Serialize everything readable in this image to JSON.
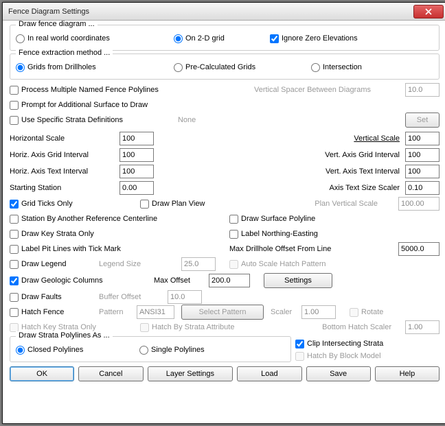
{
  "window": {
    "title": "Fence Diagram Settings"
  },
  "group_draw": {
    "legend": "Draw fence diagram ...",
    "opt_real_world": "In real world coordinates",
    "opt_on2d": "On 2-D grid",
    "ignore_zero": "Ignore Zero Elevations"
  },
  "group_extract": {
    "legend": "Fence extraction method ...",
    "opt_grids": "Grids from Drillholes",
    "opt_precalc": "Pre-Calculated Grids",
    "opt_intersect": "Intersection"
  },
  "proc_multi": "Process Multiple Named Fence Polylines",
  "vspacer_lbl": "Vertical Spacer Between Diagrams",
  "vspacer_val": "10.0",
  "prompt_add_surface": "Prompt for Additional Surface to Draw",
  "use_specific_strata": "Use Specific Strata Definitions",
  "none_lbl": "None",
  "set_btn": "Set",
  "scales": {
    "hscale_lbl": "Horizontal Scale",
    "hscale_val": "100",
    "vscale_lbl": "Vertical Scale",
    "vscale_val": "100",
    "hgrid_lbl": "Horiz. Axis Grid Interval",
    "hgrid_val": "100",
    "vgrid_lbl": "Vert. Axis Grid Interval",
    "vgrid_val": "100",
    "htext_lbl": "Horiz. Axis Text Interval",
    "htext_val": "100",
    "vtext_lbl": "Vert. Axis Text Interval",
    "vtext_val": "100",
    "start_lbl": "Starting Station",
    "start_val": "0.00",
    "atsize_lbl": "Axis Text Size Scaler",
    "atsize_val": "0.10"
  },
  "grid_ticks": "Grid Ticks Only",
  "draw_plan": "Draw Plan View",
  "plan_vscale_lbl": "Plan Vertical Scale",
  "plan_vscale_val": "100.00",
  "station_ref": "Station By Another Reference Centerline",
  "draw_surface_poly": "Draw Surface Polyline",
  "draw_key_strata": "Draw Key Strata Only",
  "label_ne": "Label Northing-Easting",
  "label_pit": "Label Pit Lines with Tick Mark",
  "max_drill_lbl": "Max Drillhole Offset From Line",
  "max_drill_val": "5000.0",
  "draw_legend": "Draw Legend",
  "legend_size_lbl": "Legend Size",
  "legend_size_val": "25.0",
  "auto_hatch": "Auto Scale Hatch Pattern",
  "draw_geo": "Draw Geologic Columns",
  "max_offset_lbl": "Max Offset",
  "max_offset_val": "200.0",
  "settings_btn": "Settings",
  "draw_faults": "Draw Faults",
  "buffer_lbl": "Buffer Offset",
  "buffer_val": "10.0",
  "hatch_fence": "Hatch Fence",
  "pattern_lbl": "Pattern",
  "pattern_val": "ANSI31",
  "select_pattern_btn": "Select Pattern",
  "scaler_lbl": "Scaler",
  "scaler_val": "1.00",
  "rotate_lbl": "Rotate",
  "hatch_key_strata": "Hatch Key Strata Only",
  "hatch_by_strata_attr": "Hatch By Strata Attribute",
  "bottom_hatch_lbl": "Bottom Hatch Scaler",
  "bottom_hatch_val": "1.00",
  "group_polylines": {
    "legend": "Draw Strata Polylines As ...",
    "opt_closed": "Closed Polylines",
    "opt_single": "Single Polylines",
    "clip_inter": "Clip Intersecting Strata",
    "hatch_block": "Hatch By Block Model"
  },
  "buttons": {
    "ok": "OK",
    "cancel": "Cancel",
    "layer": "Layer Settings",
    "load": "Load",
    "save": "Save",
    "help": "Help"
  }
}
